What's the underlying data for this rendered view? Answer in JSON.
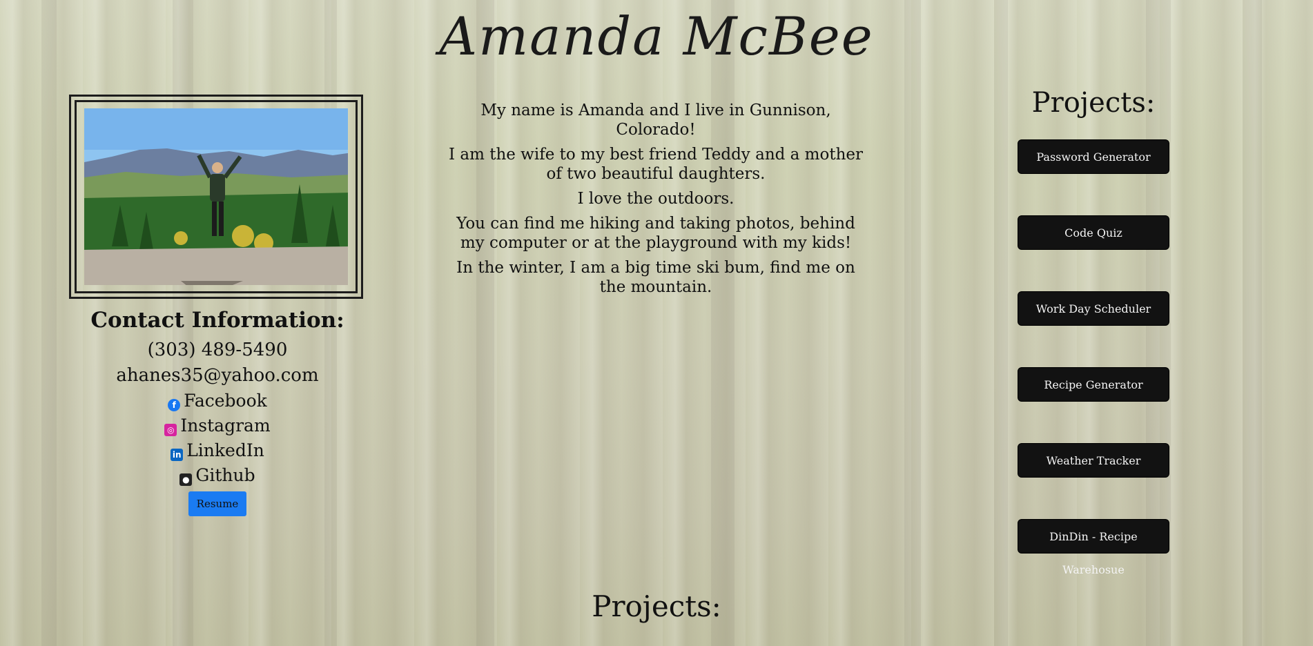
{
  "header": {
    "name": "Amanda McBee"
  },
  "contact": {
    "heading": "Contact Information:",
    "phone": "(303) 489-5490",
    "email": "ahanes35@yahoo.com",
    "links": [
      {
        "label": "Facebook",
        "icon": "facebook-icon",
        "color": "#1877f2"
      },
      {
        "label": "Instagram",
        "icon": "instagram-icon",
        "color": "#d6249f"
      },
      {
        "label": "LinkedIn",
        "icon": "linkedin-icon",
        "color": "#0a66c2"
      },
      {
        "label": "Github",
        "icon": "github-icon",
        "color": "#222222"
      }
    ],
    "resume_label": "Resume"
  },
  "about": {
    "paragraphs": [
      "My name is Amanda and I live in Gunnison, Colorado!",
      "I am the wife to my best friend Teddy and a mother of two beautiful daughters.",
      "I love the outdoors.",
      "You can find me hiking and taking photos, behind my computer or at the playground with my kids!",
      "In the winter, I am a big time ski bum, find me on the mountain."
    ]
  },
  "projects": {
    "heading": "Projects:",
    "items": [
      "Password Generator",
      "Code Quiz",
      "Work Day Scheduler",
      "Recipe Generator",
      "Weather Tracker",
      "DinDin - Recipe Warehosue"
    ]
  },
  "bottom": {
    "heading": "Projects:"
  },
  "colors": {
    "button_bg": "#121212",
    "resume_bg": "#1a7bf2"
  }
}
